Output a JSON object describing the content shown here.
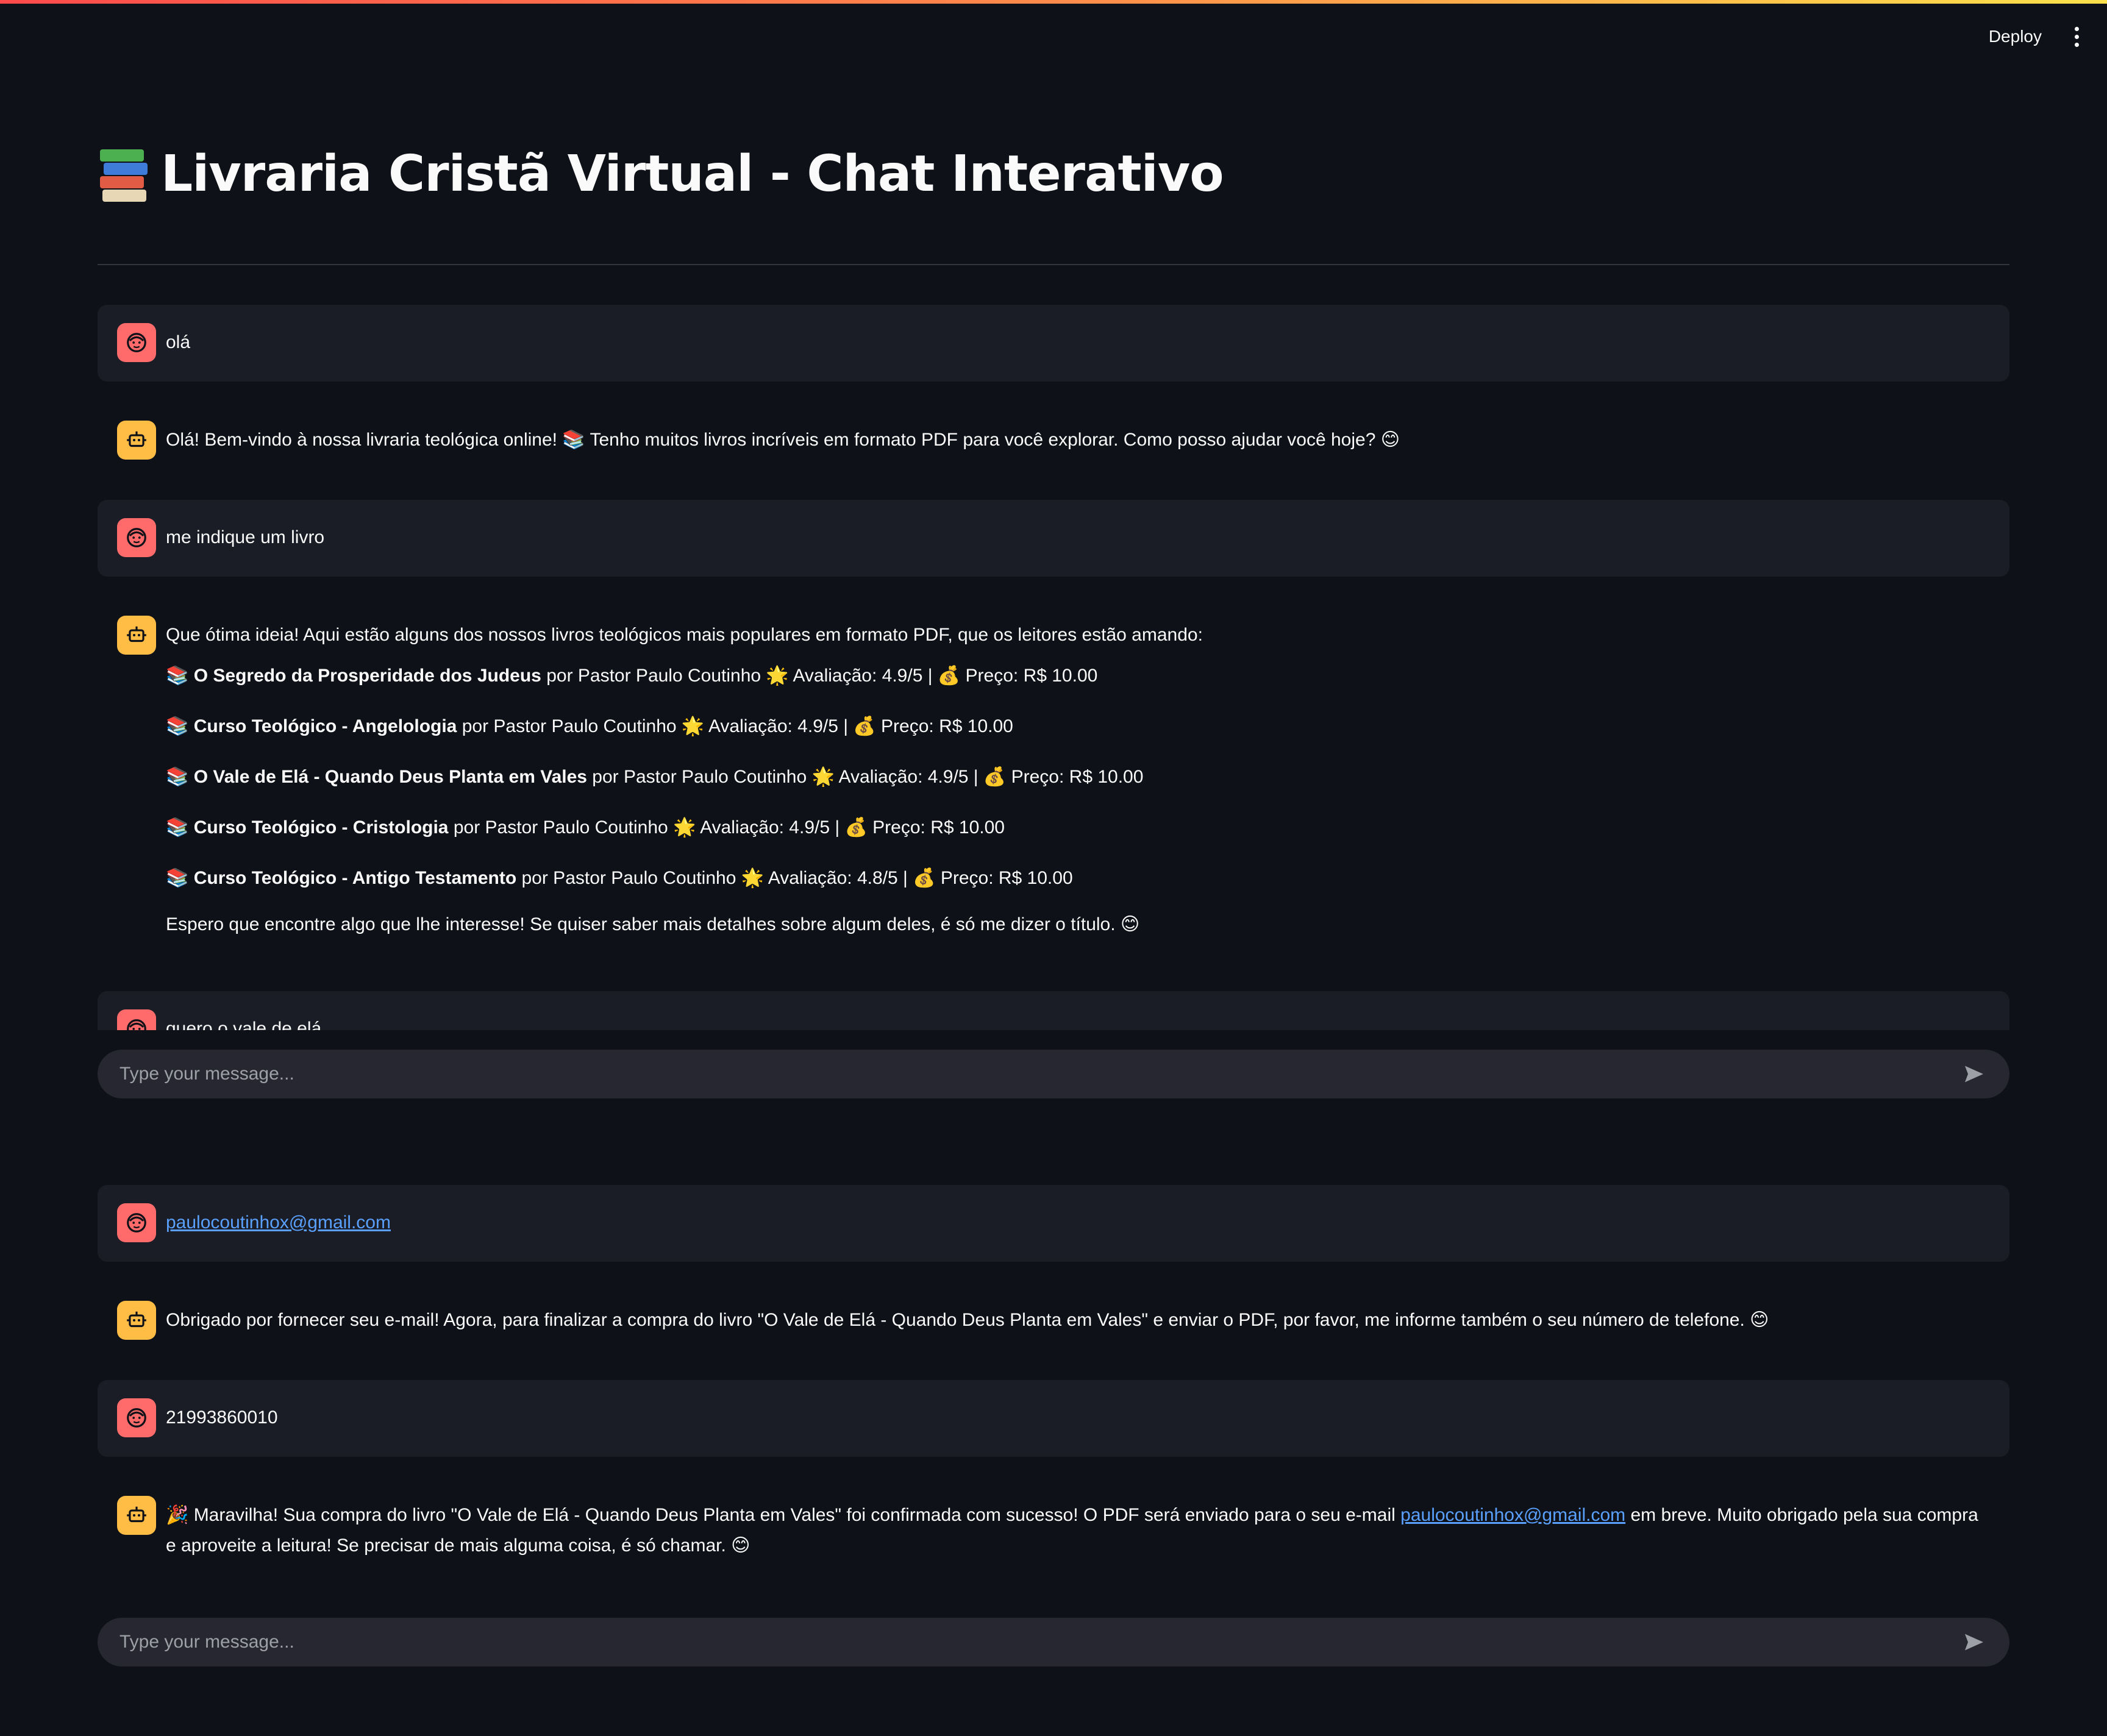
{
  "header": {
    "deploy_label": "Deploy"
  },
  "title": "Livraria Cristã Virtual - Chat Interativo",
  "messages": {
    "m1": "olá",
    "m2": "Olá! Bem-vindo à nossa livraria teológica online! 📚 Tenho muitos livros incríveis em formato PDF para você explorar. Como posso ajudar você hoje? 😊",
    "m3": "me indique um livro",
    "m4_intro": "Que ótima ideia! Aqui estão alguns dos nossos livros teológicos mais populares em formato PDF, que os leitores estão amando:",
    "m4_books": [
      {
        "title": "O Segredo da Prosperidade dos Judeus",
        "rest": " por Pastor Paulo Coutinho 🌟 Avaliação: 4.9/5 | 💰 Preço: R$ 10.00"
      },
      {
        "title": "Curso Teológico - Angelologia",
        "rest": " por Pastor Paulo Coutinho 🌟 Avaliação: 4.9/5 | 💰 Preço: R$ 10.00"
      },
      {
        "title": "O Vale de Elá - Quando Deus Planta em Vales",
        "rest": " por Pastor Paulo Coutinho 🌟 Avaliação: 4.9/5 | 💰 Preço: R$ 10.00"
      },
      {
        "title": "Curso Teológico - Cristologia",
        "rest": " por Pastor Paulo Coutinho 🌟 Avaliação: 4.9/5 | 💰 Preço: R$ 10.00"
      },
      {
        "title": "Curso Teológico - Antigo Testamento",
        "rest": " por Pastor Paulo Coutinho 🌟 Avaliação: 4.8/5 | 💰 Preço: R$ 10.00"
      }
    ],
    "m4_outro": "Espero que encontre algo que lhe interesse! Se quiser saber mais detalhes sobre algum deles, é só me dizer o título. 😊",
    "m5_partial": "quero o vale de elá",
    "m6_email": "paulocoutinhox@gmail.com",
    "m7": "Obrigado por fornecer seu e-mail! Agora, para finalizar a compra do livro \"O Vale de Elá - Quando Deus Planta em Vales\" e enviar o PDF, por favor, me informe também o seu número de telefone. 😊",
    "m8": "21993860010",
    "m9_before": "🎉 Maravilha! Sua compra do livro \"O Vale de Elá - Quando Deus Planta em Vales\" foi confirmada com sucesso! O PDF será enviado para o seu e-mail ",
    "m9_link": "paulocoutinhox@gmail.com",
    "m9_after": " em breve. Muito obrigado pela sua compra e aproveite a leitura! Se precisar de mais alguma coisa, é só chamar. 😊"
  },
  "input": {
    "placeholder": "Type your message..."
  },
  "colors": {
    "user_avatar": "#ff6b6b",
    "bot_avatar": "#ffbd45",
    "link": "#5aa0ff",
    "input_bg": "#262730"
  }
}
